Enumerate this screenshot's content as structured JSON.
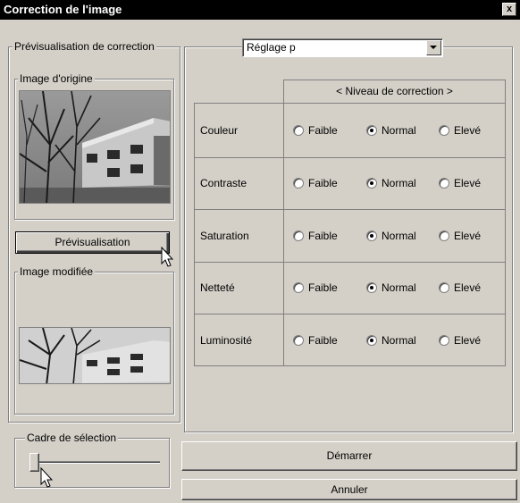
{
  "window": {
    "title": "Correction de l'image",
    "close_label": "x"
  },
  "preview_group": {
    "label": "Prévisualisation de correction"
  },
  "original_group": {
    "label": "Image d'origine"
  },
  "preview_button": {
    "label": "Prévisualisation"
  },
  "modified_group": {
    "label": "Image modifiée"
  },
  "frame_group": {
    "label": "Cadre de sélection",
    "slider_value": 0
  },
  "preset": {
    "selected": "Réglage p"
  },
  "grid": {
    "header": "< Niveau de correction >",
    "options": [
      "Faible",
      "Normal",
      "Elevé"
    ],
    "rows": [
      {
        "label": "Couleur",
        "selected": 1
      },
      {
        "label": "Contraste",
        "selected": 1
      },
      {
        "label": "Saturation",
        "selected": 1
      },
      {
        "label": "Netteté",
        "selected": 1
      },
      {
        "label": "Luminosité",
        "selected": 1
      }
    ]
  },
  "start_button": {
    "label": "Démarrer"
  },
  "cancel_button": {
    "label": "Annuler"
  }
}
